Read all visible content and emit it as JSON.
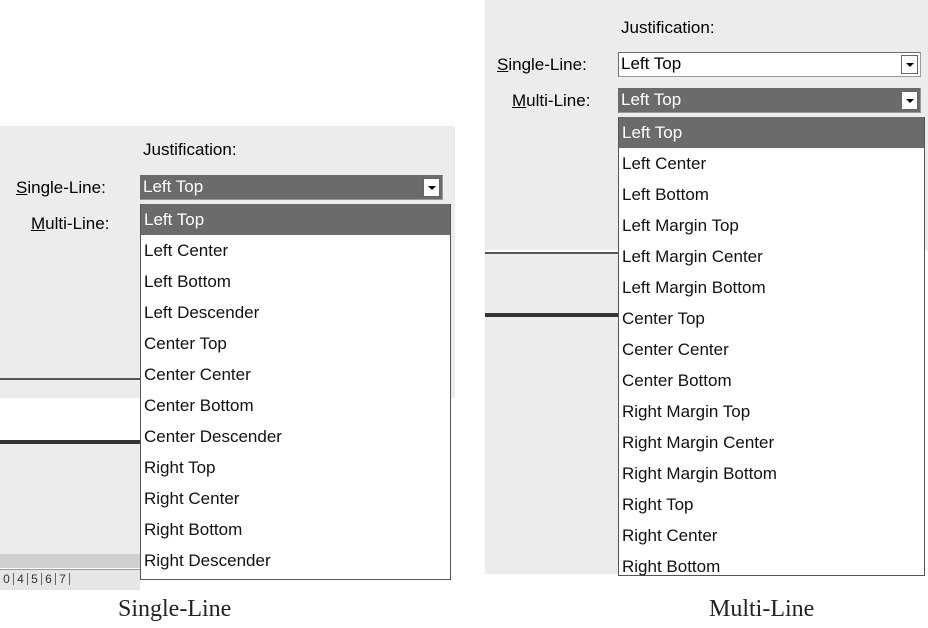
{
  "left": {
    "heading": "Justification:",
    "single_line_label_ul": "S",
    "single_line_label_rest": "ingle-Line:",
    "multi_line_label_ul": "M",
    "multi_line_label_rest": "ulti-Line:",
    "single_line_value": "Left Top",
    "options": [
      "Left Top",
      "Left Center",
      "Left Bottom",
      "Left Descender",
      "Center Top",
      "Center Center",
      "Center Bottom",
      "Center Descender",
      "Right Top",
      "Right Center",
      "Right Bottom",
      "Right Descender"
    ],
    "caption": "Single-Line"
  },
  "right": {
    "heading": "Justification:",
    "single_line_label_ul": "S",
    "single_line_label_rest": "ingle-Line:",
    "multi_line_label_ul": "M",
    "multi_line_label_rest": "ulti-Line:",
    "single_line_value": "Left Top",
    "multi_line_value": "Left Top",
    "options": [
      "Left Top",
      "Left Center",
      "Left Bottom",
      "Left Margin Top",
      "Left Margin Center",
      "Left Margin Bottom",
      "Center Top",
      "Center Center",
      "Center Bottom",
      "Right Margin Top",
      "Right Margin Center",
      "Right Margin Bottom",
      "Right Top",
      "Right Center",
      "Right Bottom"
    ],
    "caption": "Multi-Line"
  },
  "colors": {
    "selected": "#6b6b6b",
    "panel": "#ececec"
  }
}
